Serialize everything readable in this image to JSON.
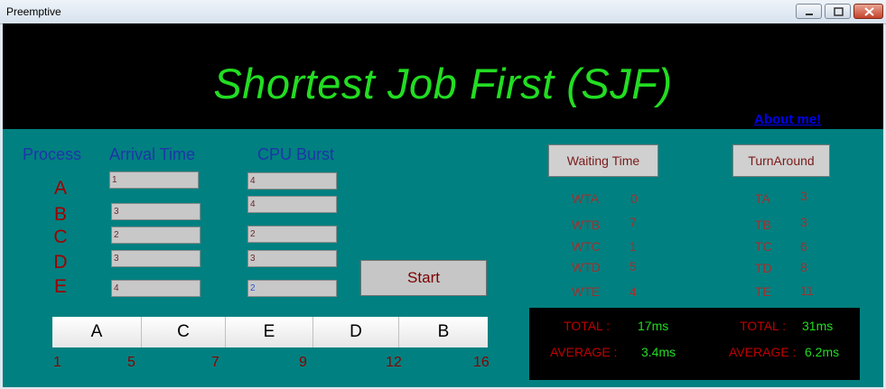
{
  "window": {
    "title": "Preemptive"
  },
  "header": {
    "title": "Shortest Job First  (SJF)",
    "about_link": "About me!"
  },
  "columns": {
    "process": "Process",
    "arrival": "Arrival Time",
    "burst": "CPU Burst"
  },
  "processes": [
    {
      "name": "A",
      "arrival": "1",
      "burst": "4"
    },
    {
      "name": "B",
      "arrival": "3",
      "burst": "4"
    },
    {
      "name": "C",
      "arrival": "2",
      "burst": "2"
    },
    {
      "name": "D",
      "arrival": "3",
      "burst": "3"
    },
    {
      "name": "E",
      "arrival": "4",
      "burst": "2"
    }
  ],
  "start_label": "Start",
  "waiting_button": "Waiting Time",
  "turnaround_button": "TurnAround",
  "waiting": [
    {
      "label": "WTA",
      "value": "0"
    },
    {
      "label": "WTB",
      "value": "7"
    },
    {
      "label": "WTC",
      "value": "1"
    },
    {
      "label": "WTD",
      "value": "5"
    },
    {
      "label": "WTE",
      "value": "4"
    }
  ],
  "turnaround": [
    {
      "label": "TA",
      "value": "3"
    },
    {
      "label": "TB",
      "value": "3"
    },
    {
      "label": "TC",
      "value": "6"
    },
    {
      "label": "TD",
      "value": "8"
    },
    {
      "label": "TE",
      "value": "11"
    }
  ],
  "gantt": {
    "blocks": [
      "A",
      "C",
      "E",
      "D",
      "B"
    ],
    "times": [
      "1",
      "5",
      "7",
      "9",
      "12",
      "16"
    ]
  },
  "totals": {
    "total_label": "TOTAL :",
    "average_label": "AVERAGE :",
    "waiting_total": "17ms",
    "waiting_average": "3.4ms",
    "turnaround_total": "31ms",
    "turnaround_average": "6.2ms"
  },
  "colors": {
    "title_green": "#22dd22",
    "panel_teal": "#008080",
    "label_blue": "#1e35a8",
    "process_red": "#a00000"
  }
}
